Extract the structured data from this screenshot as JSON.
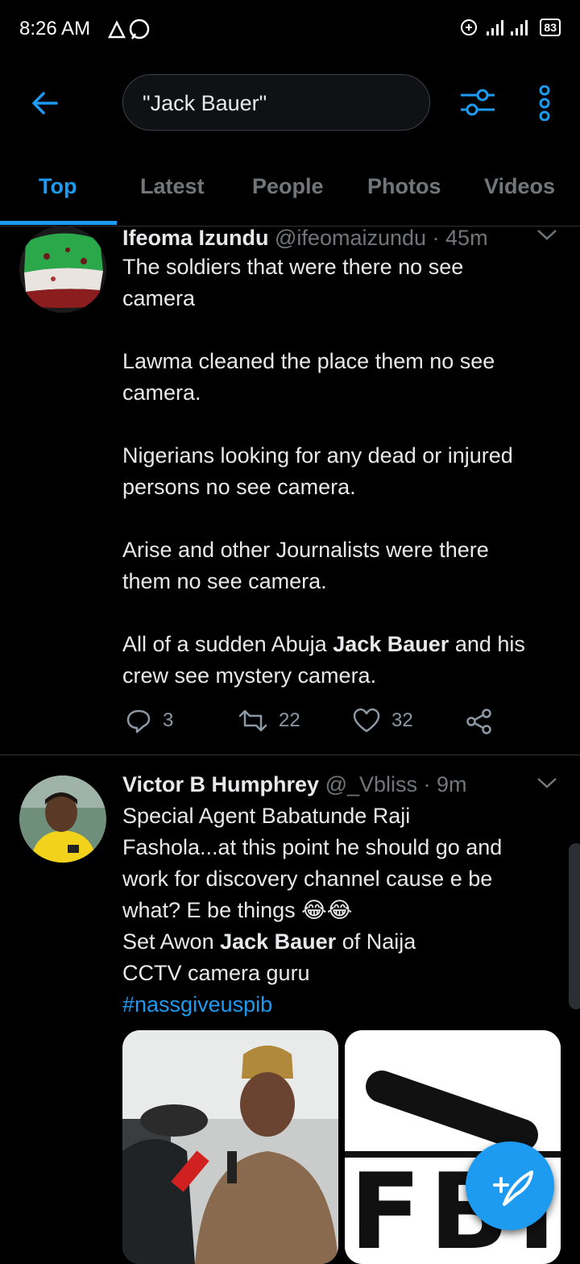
{
  "status_bar": {
    "time": "8:26 AM",
    "battery": "83"
  },
  "search": {
    "query": "\"Jack Bauer\""
  },
  "tabs": [
    {
      "label": "Top"
    },
    {
      "label": "Latest"
    },
    {
      "label": "People"
    },
    {
      "label": "Photos"
    },
    {
      "label": "Videos"
    }
  ],
  "tweets": [
    {
      "name": "Ifeoma Izundu",
      "handle": "@ifeomaizundu",
      "time": "· 45m",
      "lines": [
        "The soldiers that were there no see",
        "camera",
        "",
        "Lawma cleaned the place them no see",
        "camera.",
        "",
        "Nigerians looking for any dead or injured",
        "persons no see camera.",
        "",
        "Arise and other Journalists were there",
        "them no see camera."
      ],
      "last_line_pre": "All of a sudden Abuja ",
      "last_line_bold": "Jack Bauer",
      "last_line_post": " and his",
      "final_line": "crew see mystery camera.",
      "replies": "3",
      "retweets": "22",
      "likes": "32"
    },
    {
      "name": "Victor B Humphrey",
      "handle": "@_Vbliss",
      "time": "· 9m",
      "lines": [
        "Special Agent Babatunde Raji",
        "Fashola...at this point he should go and",
        "work for discovery channel cause e be",
        "what? E be things 😂😂"
      ],
      "line5_pre": "Set Awon ",
      "line5_bold": "Jack Bauer",
      "line5_post": " of Naija",
      "line6": "CCTV camera guru",
      "hashtag": "#nassgiveuspib",
      "media_right_text": "FBI"
    }
  ],
  "colors": {
    "accent": "#1d9bf0",
    "background": "#000000",
    "muted": "#71767b"
  },
  "icons": [
    "back-arrow-icon",
    "filter-icon",
    "more-vertical-icon",
    "reply-icon",
    "retweet-icon",
    "like-icon",
    "share-icon",
    "compose-tweet-icon"
  ]
}
